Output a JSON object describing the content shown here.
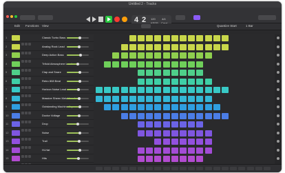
{
  "window": {
    "title": "Untitled 2 - Tracks"
  },
  "toolbar": {
    "lcd_bar": "4",
    "lcd_beat": "2",
    "lcd_tempo": "120",
    "lcd_tempo_label": "KEEP",
    "lcd_sig": "4/4",
    "lcd_key": "Cmaj"
  },
  "subbar": {
    "edit": "Edit",
    "functions": "Functions",
    "view": "View",
    "snap_label": "Quantize Start",
    "snap_value": "1 Bar"
  },
  "tracks": [
    {
      "num": "1",
      "name": "Classic Turbo Bass",
      "color": "#c8d64a"
    },
    {
      "num": "2",
      "name": "Analog Rock Lead",
      "color": "#c8d64a"
    },
    {
      "num": "3",
      "name": "Deep Action Bass",
      "color": "#8fcf4e"
    },
    {
      "num": "4",
      "name": "Trifold Atmosphere Lead",
      "color": "#6fcf5a"
    },
    {
      "num": "5",
      "name": "Clap and Snare",
      "color": "#4fcf8a"
    },
    {
      "num": "6",
      "name": "Retro 808 Beat",
      "color": "#3fcfa6"
    },
    {
      "num": "7",
      "name": "Horizon Noise Lead",
      "color": "#38c9c6"
    },
    {
      "num": "8",
      "name": "Massive Sheen Metal Lead",
      "color": "#34b7d6"
    },
    {
      "num": "9",
      "name": "Outstanding Machine Arp",
      "color": "#2f9ee0"
    },
    {
      "num": "10",
      "name": "Doctor Voltage",
      "color": "#4b7de6"
    },
    {
      "num": "11",
      "name": "Drop",
      "color": "#6b63e6"
    },
    {
      "num": "12",
      "name": "Noise",
      "color": "#7f56e0"
    },
    {
      "num": "13",
      "name": "Trail",
      "color": "#9250de"
    },
    {
      "num": "14",
      "name": "Hi-Hat",
      "color": "#a34cd6"
    },
    {
      "num": "15",
      "name": "Hits",
      "color": "#b24bd0"
    }
  ]
}
